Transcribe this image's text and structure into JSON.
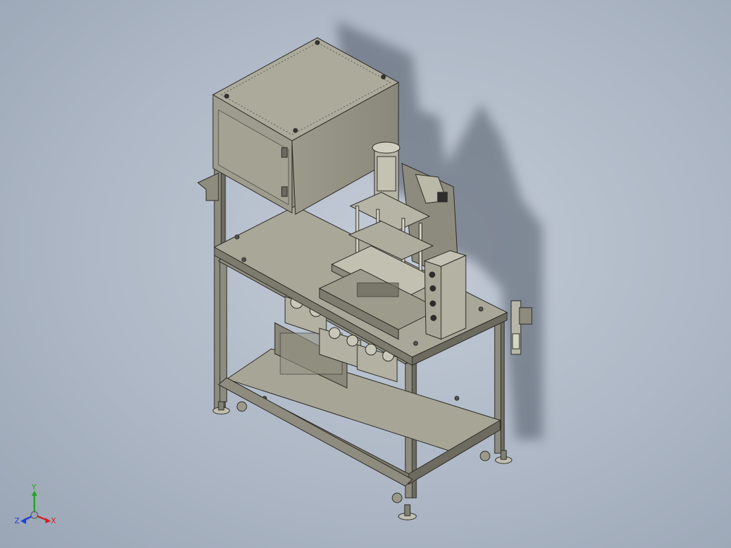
{
  "viewport": {
    "background_top": "#c3cbd6",
    "background_bottom": "#9aa5b5"
  },
  "model": {
    "description_icon": "isometric-machine-assembly",
    "frame_color": "#8e8c7f",
    "panel_color": "#a7a596",
    "edge_color": "#2b2a25",
    "shadow_color": "#4f5866"
  },
  "triad": {
    "x_label": "X",
    "y_label": "Y",
    "z_label": "Z",
    "x_color": "#d42020",
    "y_color": "#1fa81f",
    "z_color": "#1e3fd6"
  }
}
